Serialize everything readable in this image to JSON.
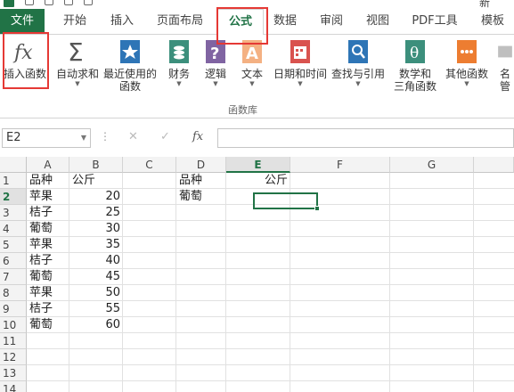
{
  "titlebar": {
    "partial_title": "新"
  },
  "tabs": [
    {
      "label": "文件"
    },
    {
      "label": "开始"
    },
    {
      "label": "插入"
    },
    {
      "label": "页面布局"
    },
    {
      "label": "公式"
    },
    {
      "label": "数据"
    },
    {
      "label": "审阅"
    },
    {
      "label": "视图"
    },
    {
      "label": "PDF工具"
    },
    {
      "label": "模板"
    }
  ],
  "ribbon": {
    "insert_function": "插入函数",
    "autosum": "自动求和",
    "recent_1": "最近使用的",
    "recent_2": "函数",
    "financial": "财务",
    "logical": "逻辑",
    "text": "文本",
    "datetime": "日期和时间",
    "lookup": "查找与引用",
    "math_1": "数学和",
    "math_2": "三角函数",
    "other": "其他函数",
    "name_mgr_1": "名",
    "name_mgr_2": "管",
    "group_label": "函数库"
  },
  "formula_bar": {
    "name_box": "E2",
    "value": ""
  },
  "grid": {
    "columns": [
      "A",
      "B",
      "C",
      "D",
      "E",
      "F",
      "G"
    ],
    "rows": [
      "1",
      "2",
      "3",
      "4",
      "5",
      "6",
      "7",
      "8",
      "9",
      "10",
      "11",
      "12",
      "13",
      "14"
    ],
    "selected_col": "E",
    "selected_row": "2",
    "cells": {
      "A1": "品种",
      "B1": "公斤",
      "A2": "苹果",
      "B2": "20",
      "A3": "桔子",
      "B3": "25",
      "A4": "葡萄",
      "B4": "30",
      "A5": "苹果",
      "B5": "35",
      "A6": "桔子",
      "B6": "40",
      "A7": "葡萄",
      "B7": "45",
      "A8": "苹果",
      "B8": "50",
      "A9": "桔子",
      "B9": "55",
      "A10": "葡萄",
      "B10": "60",
      "D1": "品种",
      "E1": "公斤",
      "D2": "葡萄"
    }
  },
  "colors": {
    "accent": "#217346",
    "highlight": "#e53935"
  }
}
